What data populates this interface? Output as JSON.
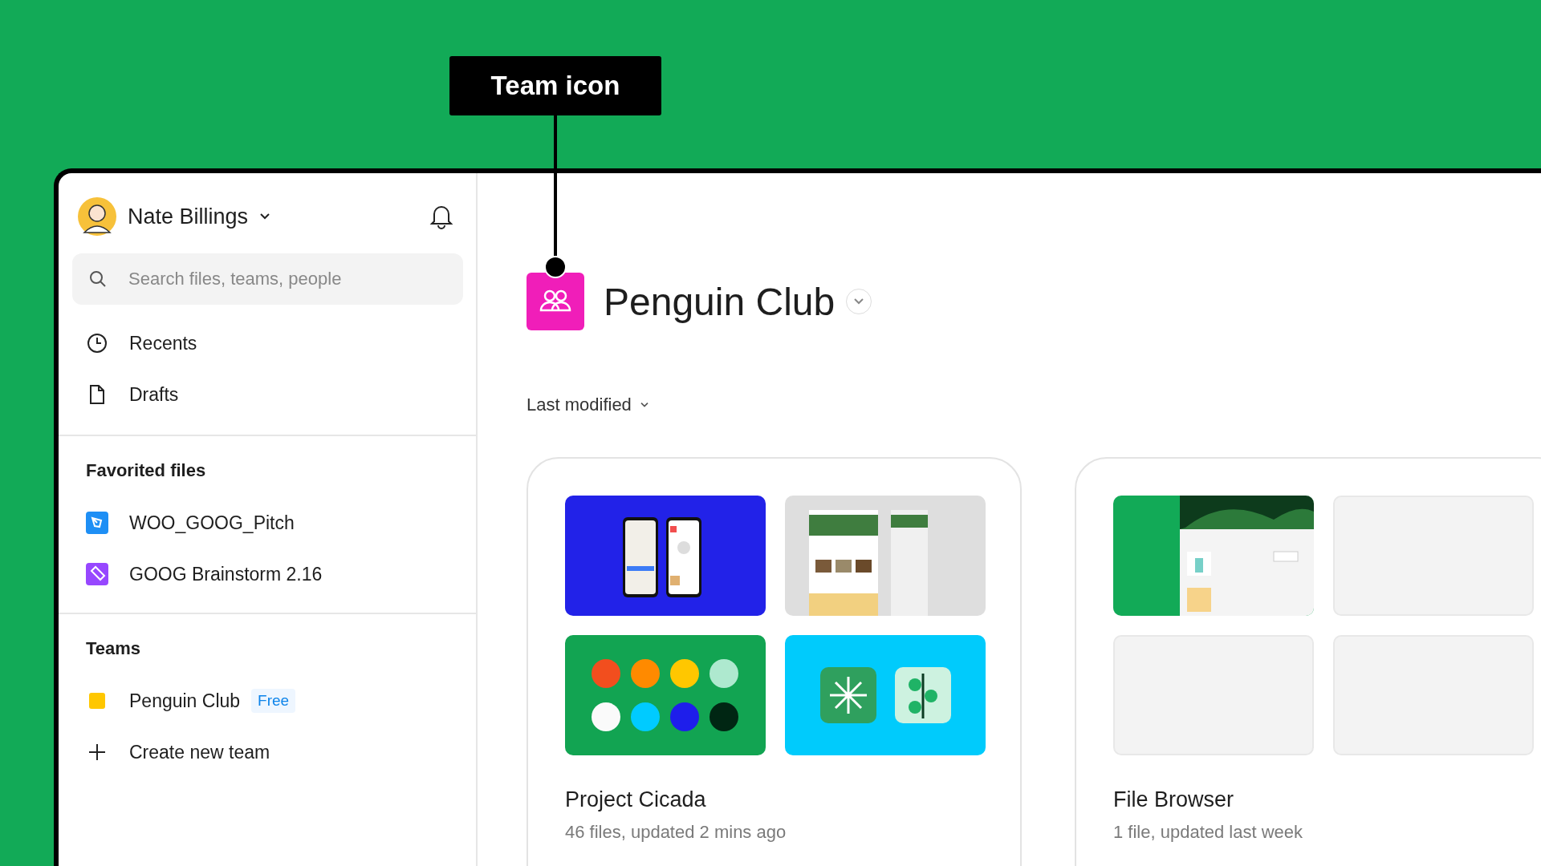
{
  "annotation": {
    "label": "Team icon"
  },
  "sidebar": {
    "user": {
      "name": "Nate Billings"
    },
    "search": {
      "placeholder": "Search files, teams, people"
    },
    "nav": [
      {
        "label": "Recents",
        "kind": "clock"
      },
      {
        "label": "Drafts",
        "kind": "file"
      }
    ],
    "favorites": {
      "heading": "Favorited files",
      "items": [
        {
          "name": "WOO_GOOG_Pitch",
          "kind": "design",
          "color": "#1e8ff5"
        },
        {
          "name": "GOOG Brainstorm 2.16",
          "kind": "whiteboard",
          "color": "#9747ff"
        }
      ]
    },
    "teams": {
      "heading": "Teams",
      "items": [
        {
          "name": "Penguin Club",
          "color": "#ffc700",
          "badge": "Free"
        }
      ],
      "create": "Create new team"
    }
  },
  "main": {
    "team": {
      "name": "Penguin Club"
    },
    "sort": {
      "label": "Last modified"
    },
    "projects": [
      {
        "name": "Project Cicada",
        "meta": "46 files, updated 2 mins ago",
        "thumbnails": [
          {
            "kind": "phones"
          },
          {
            "kind": "website"
          },
          {
            "kind": "palette",
            "swatches": [
              {
                "color": "#f24e1e"
              },
              {
                "color": "#ff8a00"
              },
              {
                "color": "#ffc700"
              },
              {
                "color": "#aee9cf"
              },
              {
                "color": "#fafafa"
              },
              {
                "color": "#00cbff"
              },
              {
                "color": "#1e1eeb"
              },
              {
                "color": "#002613"
              }
            ]
          },
          {
            "kind": "app-icons"
          }
        ]
      },
      {
        "name": "File Browser",
        "meta": "1 file, updated last week",
        "thumbnails": [
          {
            "kind": "shop"
          },
          {
            "kind": "empty"
          },
          {
            "kind": "empty"
          },
          {
            "kind": "empty"
          }
        ]
      }
    ]
  }
}
